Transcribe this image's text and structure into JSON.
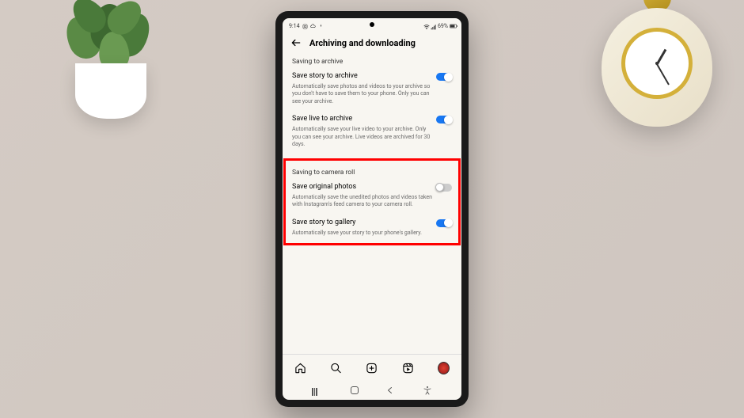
{
  "status_bar": {
    "time": "9:14",
    "battery_text": "69%"
  },
  "header": {
    "title": "Archiving and downloading"
  },
  "sections": {
    "archive": {
      "label": "Saving to archive",
      "items": [
        {
          "title": "Save story to archive",
          "desc": "Automatically save photos and videos to your archive so you don't have to save them to your phone. Only you can see your archive.",
          "toggle": true
        },
        {
          "title": "Save live to archive",
          "desc": "Automatically save your live video to your archive. Only you can see your archive. Live videos are archived for 30 days.",
          "toggle": true
        }
      ]
    },
    "camera_roll": {
      "label": "Saving to camera roll",
      "items": [
        {
          "title": "Save original photos",
          "desc": "Automatically save the unedited photos and videos taken with Instagram's feed camera to your camera roll.",
          "toggle": false
        },
        {
          "title": "Save story to gallery",
          "desc": "Automatically save your story to your phone's gallery.",
          "toggle": true
        }
      ]
    }
  }
}
